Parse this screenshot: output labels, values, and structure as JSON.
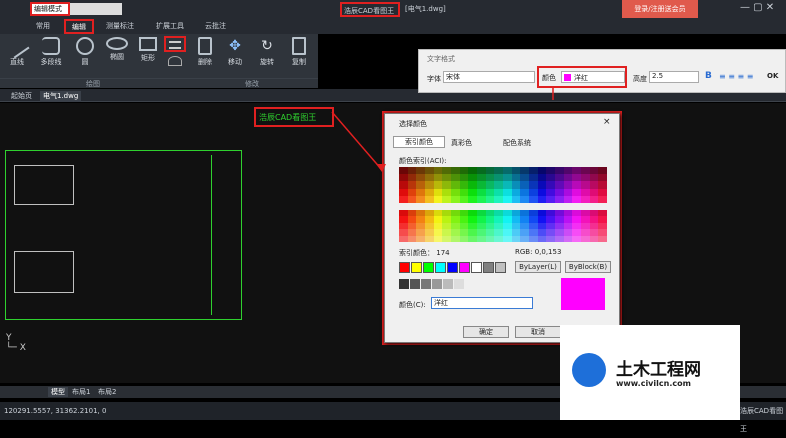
{
  "titlebar": {
    "mode": "编辑模式",
    "app": "浩辰CAD看图王",
    "doc": "[电气1.dwg]",
    "login": "登录/注册送会员"
  },
  "tabs": [
    "常用",
    "编辑",
    "测量标注",
    "扩展工具",
    "云批注"
  ],
  "tools": [
    {
      "label": "直线"
    },
    {
      "label": "多段线"
    },
    {
      "label": "圆"
    },
    {
      "label": "椭圆"
    },
    {
      "label": "矩形"
    },
    {
      "label": "删除"
    },
    {
      "label": "移动"
    },
    {
      "label": "旋转"
    },
    {
      "label": "复制"
    }
  ],
  "sections": {
    "draw": "绘图",
    "modify": "修改"
  },
  "doctabs": [
    "起始页",
    "电气1.dwg"
  ],
  "text_format": {
    "title": "文字格式",
    "font_label": "字体",
    "font": "宋体",
    "color_label": "颜色",
    "color": "洋红",
    "height_label": "高度",
    "height": "2.5",
    "bold": "B",
    "ok": "OK"
  },
  "canvas_text": "浩辰CAD看图王",
  "dialog": {
    "title": "选择颜色",
    "tabs": [
      "索引颜色",
      "真彩色",
      "配色系统"
    ],
    "aci_label": "颜色索引(ACI):",
    "index_label": "索引颜色：",
    "index_value": "174",
    "rgb_label": "RGB:",
    "rgb_value": "0,0,153",
    "bylayer": "ByLayer(L)",
    "byblock": "ByBlock(B)",
    "color_label": "颜色(C):",
    "color_value": "洋红",
    "ok": "确定",
    "cancel": "取消",
    "close": "×"
  },
  "bottom_tabs": [
    "模型",
    "布局1",
    "布局2"
  ],
  "status": {
    "coords": "120291.5557, 31362.2101, 0",
    "brand": "浩辰CAD看图王"
  },
  "logo": {
    "main": "土木工程网",
    "url": "www.civilcn.com"
  },
  "colors": {
    "accent": "#e05a4c",
    "magenta": "#ff00ff",
    "green": "#2fd12f"
  }
}
